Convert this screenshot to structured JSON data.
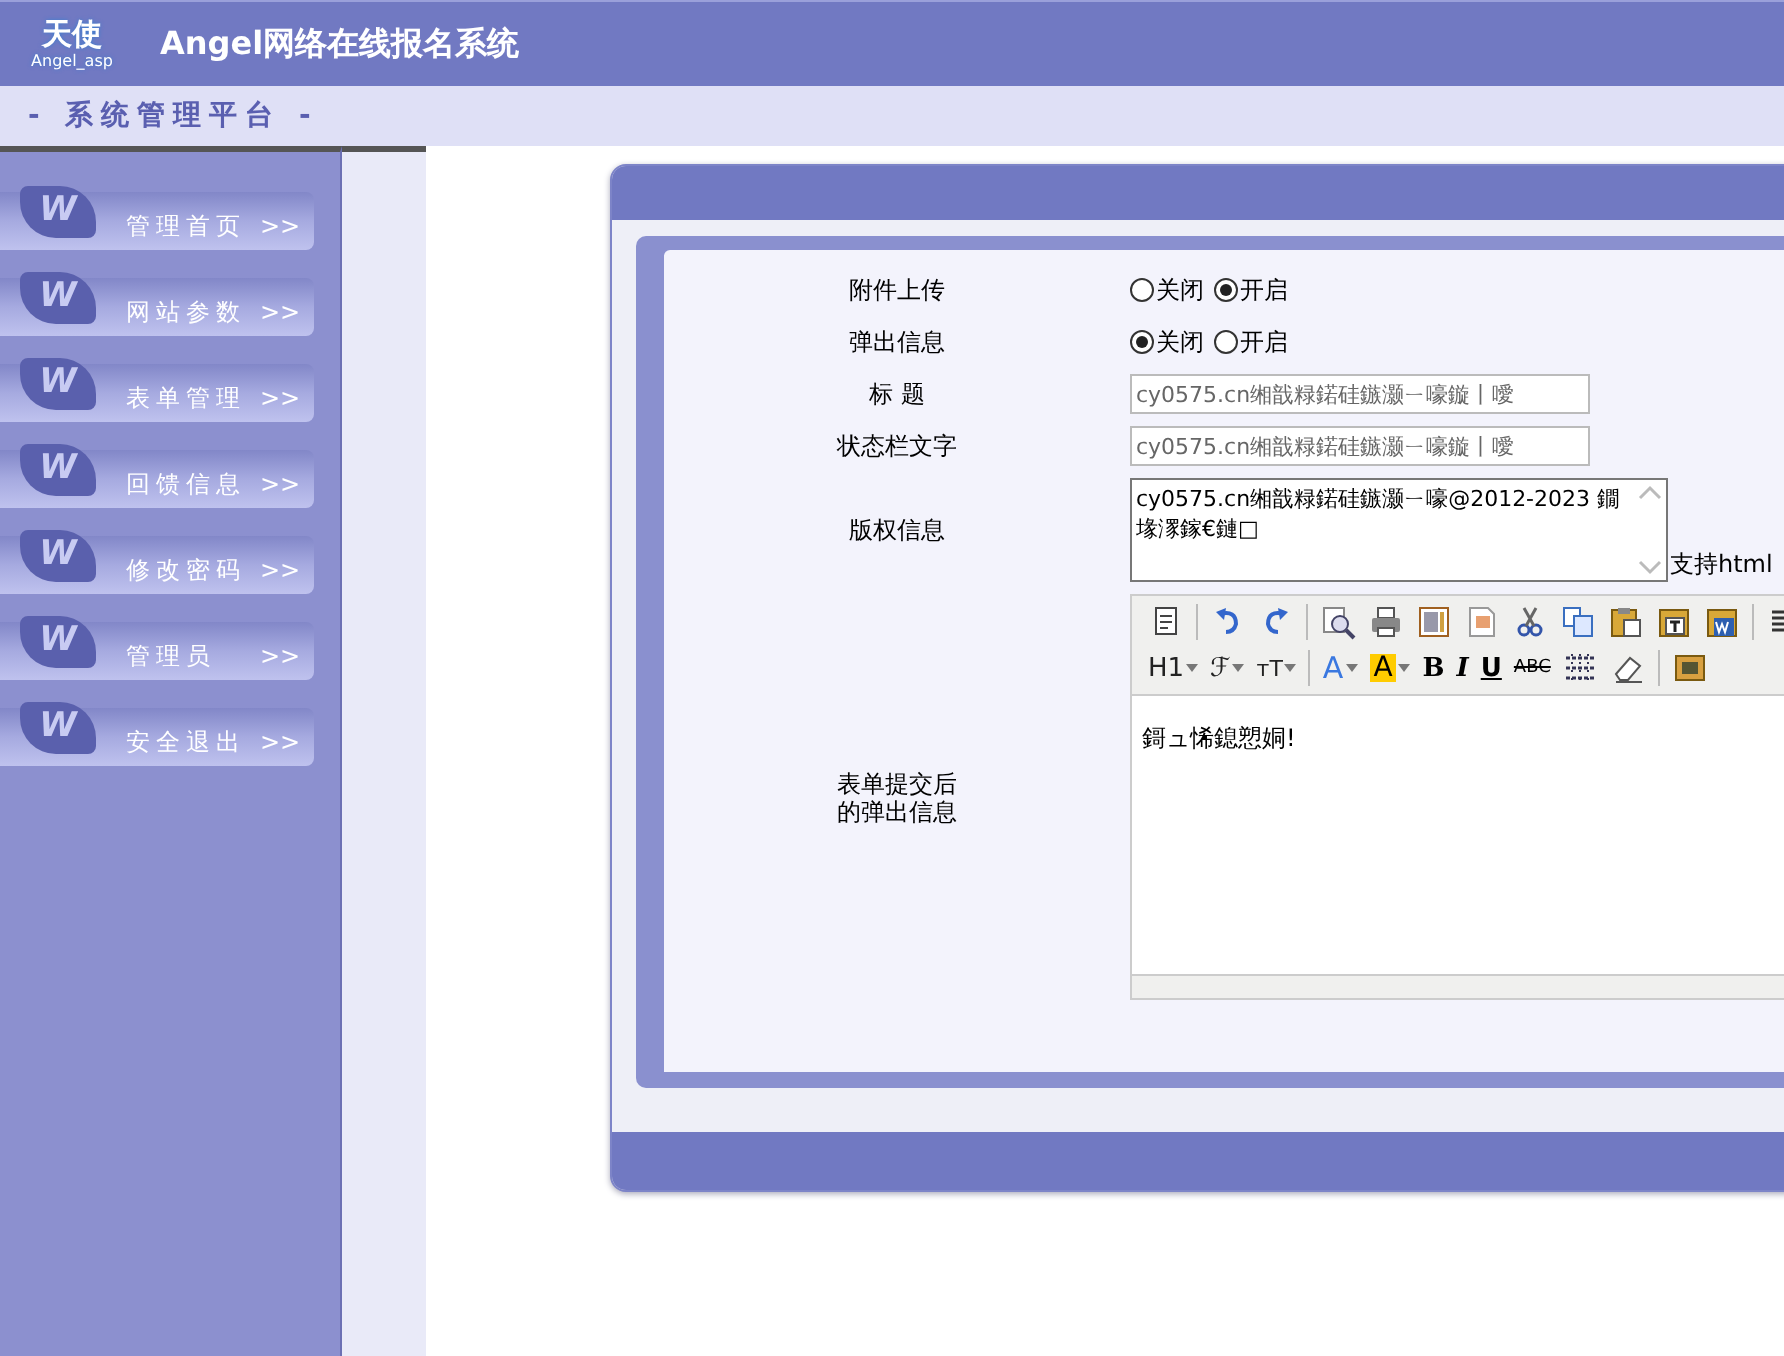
{
  "header": {
    "logo_text": "天使",
    "logo_subtext": "Angel_asp",
    "title": "Angel网络在线报名系统"
  },
  "subheader": {
    "title": "- 系统管理平台 -"
  },
  "sidebar": {
    "items": [
      {
        "badge": "W",
        "label": "管理首页",
        "arrow": ">>"
      },
      {
        "badge": "W",
        "label": "网站参数",
        "arrow": ">>"
      },
      {
        "badge": "W",
        "label": "表单管理",
        "arrow": ">>"
      },
      {
        "badge": "W",
        "label": "回馈信息",
        "arrow": ">>"
      },
      {
        "badge": "W",
        "label": "修改密码",
        "arrow": ">>"
      },
      {
        "badge": "W",
        "label": "管理员",
        "arrow": ">>"
      },
      {
        "badge": "W",
        "label": "安全退出",
        "arrow": ">>"
      }
    ]
  },
  "form": {
    "rows": [
      {
        "kind": "radio",
        "label": "附件上传",
        "options": [
          {
            "label": "关闭",
            "selected": false
          },
          {
            "label": "开启",
            "selected": true
          }
        ]
      },
      {
        "kind": "radio",
        "label": "弹出信息",
        "options": [
          {
            "label": "关闭",
            "selected": true
          },
          {
            "label": "开启",
            "selected": false
          }
        ]
      },
      {
        "kind": "input",
        "label": "标 题",
        "value": "cy0575.cn缃戠粶鍩硅鏃灏ㄧ嚎鏇丨噯"
      },
      {
        "kind": "input",
        "label": "状态栏文字",
        "value": "cy0575.cn缃戠粶鍩硅鏃灏ㄧ嚎鏇丨噯"
      },
      {
        "kind": "textarea",
        "label": "版权信息",
        "value": "cy0575.cn缃戠粶鍩硅鏃灏ㄧ嚎@2012-2023  鐗堟潈鎵€鏈□",
        "note": "支持html"
      },
      {
        "kind": "editor",
        "label": "表单提交后的弹出信息",
        "toolbar": [
          [
            {
              "kind": "icon"
            },
            {
              "kind": "sep"
            },
            {
              "kind": "icon"
            },
            {
              "kind": "icon"
            },
            {
              "kind": "sep"
            },
            {
              "kind": "icon"
            },
            {
              "kind": "icon"
            },
            {
              "kind": "icon"
            },
            {
              "kind": "icon"
            },
            {
              "kind": "icon"
            },
            {
              "kind": "icon"
            },
            {
              "kind": "icon"
            },
            {
              "kind": "icon"
            },
            {
              "kind": "icon"
            },
            {
              "kind": "sep"
            },
            {
              "kind": "icon"
            }
          ],
          [
            {
              "kind": "text",
              "label": "H1",
              "dropdown": true
            },
            {
              "kind": "text",
              "label": "ℱ",
              "dropdown": true
            },
            {
              "kind": "text",
              "label": "тT",
              "dropdown": true
            },
            {
              "kind": "sep"
            },
            {
              "kind": "text",
              "label": "A",
              "dropdown": true
            },
            {
              "kind": "text",
              "label": "A",
              "dropdown": true
            },
            {
              "kind": "text",
              "label": "B",
              "dropdown": false
            },
            {
              "kind": "text",
              "label": "I",
              "dropdown": false
            },
            {
              "kind": "text",
              "label": "U",
              "dropdown": false
            },
            {
              "kind": "text",
              "label": "ABC",
              "dropdown": false
            },
            {
              "kind": "icon"
            },
            {
              "kind": "icon"
            },
            {
              "kind": "sep"
            },
            {
              "kind": "icon"
            }
          ]
        ],
        "content": "鎶ュ悕鎴愬姛!"
      }
    ]
  }
}
